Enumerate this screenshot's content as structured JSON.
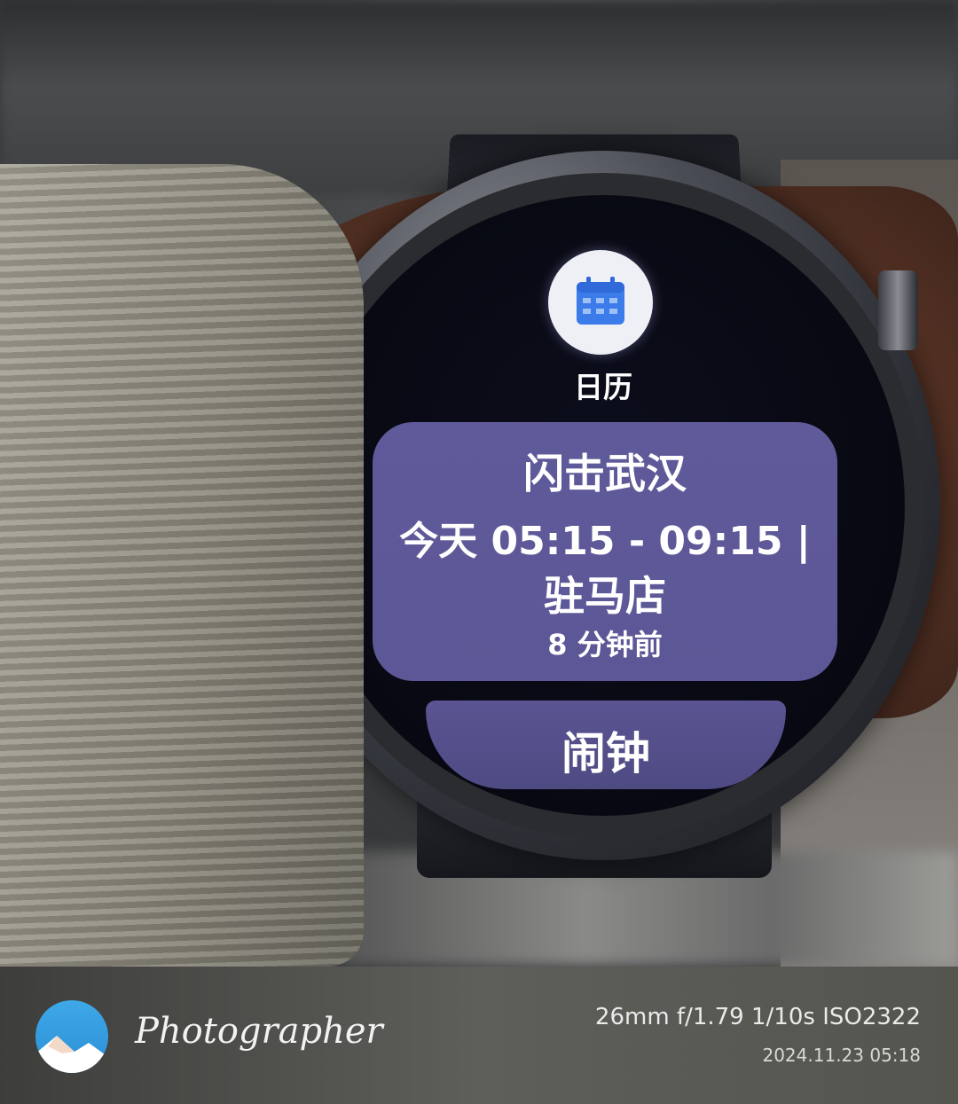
{
  "watch": {
    "app_name": "日历",
    "event": {
      "title": "闪击武汉",
      "time": "今天 05:15 - 09:15 |",
      "location": "驻马店",
      "ago": "8 分钟前"
    },
    "next_item_label": "闹钟"
  },
  "footer": {
    "brand": "Photographer",
    "exif": "26mm  f/1.79  1/10s  ISO2322",
    "datetime": "2024.11.23 05:18"
  },
  "colors": {
    "card": "#5f5a9a",
    "calendar_icon": "#3b7bea",
    "logo": "#3fa8e8"
  }
}
